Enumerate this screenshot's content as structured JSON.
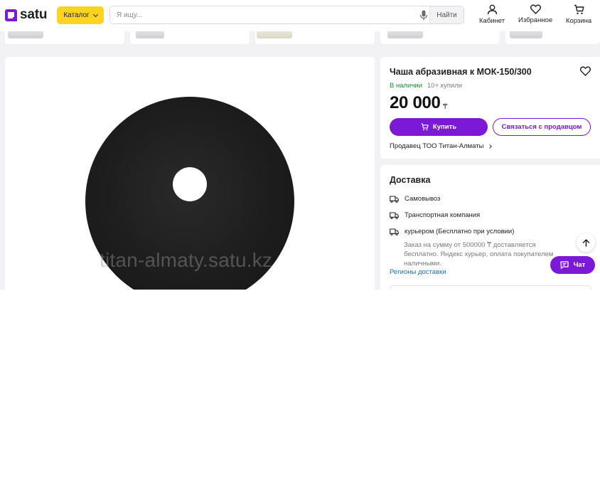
{
  "header": {
    "logo_text": "satu",
    "catalog_label": "Каталог",
    "search_placeholder": "Я ищу...",
    "search_button": "Найти",
    "nav": {
      "cabinet": "Кабинет",
      "favorites": "Избранное",
      "cart": "Корзина"
    }
  },
  "product": {
    "title": "Чаша абразивная к МОК-150/300",
    "stock": "В наличии",
    "bought": "10+ купили",
    "price": "20 000",
    "currency": "₸",
    "buy_label": "Купить",
    "contact_label": "Связаться с продавцом",
    "seller": "Продавец ТОО Титан-Алматы"
  },
  "image": {
    "watermark": "titan-almaty.satu.kz"
  },
  "delivery": {
    "title": "Доставка",
    "options": [
      {
        "label": "Самовывоз",
        "icon": "truck-icon"
      },
      {
        "label": "Транспортная компания",
        "icon": "truck-icon"
      },
      {
        "label": "курьером (Бесплатно при условии)",
        "icon": "truck-icon"
      }
    ],
    "courier_note": "Заказ на сумму от 500000 ₸ доставляется бесплатно. Яндекс курьер, оплата покупателем наличными.",
    "regions_link": "Регионы доставки"
  },
  "floating": {
    "chat_label": "Чат"
  },
  "colors": {
    "brand_purple": "#7c19d6",
    "catalog_yellow": "#ffd31f",
    "stock_green": "#1a8f36",
    "link_blue": "#1d6fb8"
  }
}
